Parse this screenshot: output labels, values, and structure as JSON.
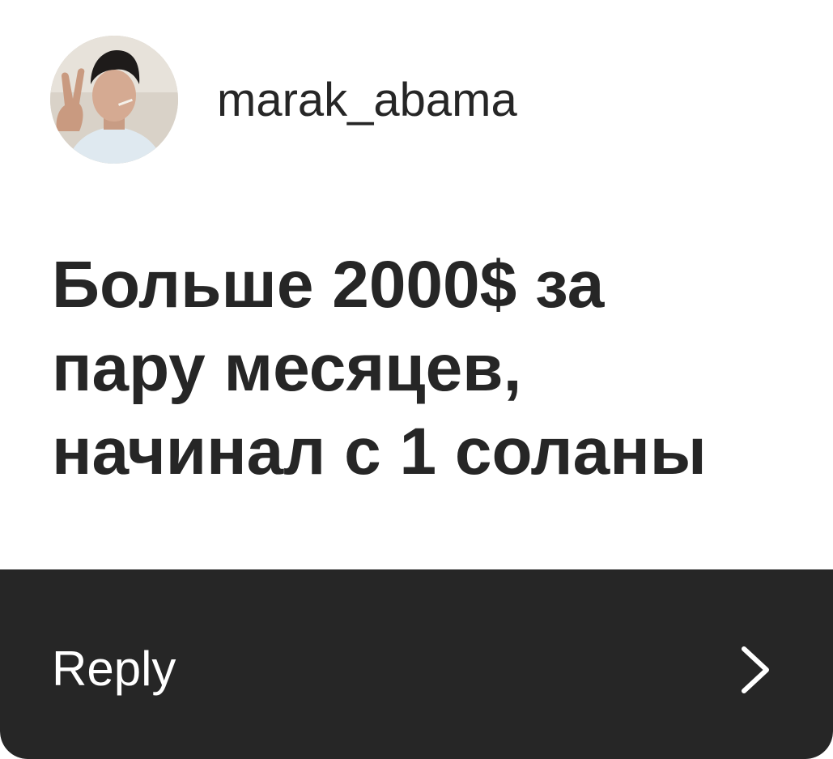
{
  "post": {
    "username": "marak_abama",
    "message_lines": [
      "Больше 2000$ за",
      "пару месяцев,",
      "начинал с 1 соланы"
    ]
  },
  "reply": {
    "label": "Reply",
    "icon": "chevron-right-icon"
  },
  "colors": {
    "text": "#262626",
    "bar": "#262626",
    "background": "#ffffff"
  }
}
